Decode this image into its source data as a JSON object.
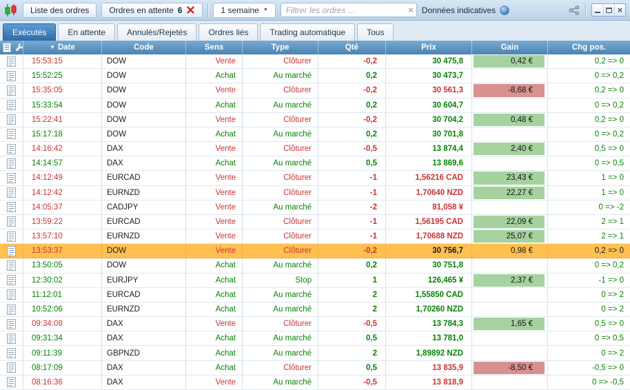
{
  "toolbar": {
    "list_button": "Liste des ordres",
    "pending_button": {
      "label": "Ordres en attente",
      "count": "6"
    },
    "period": "1 semaine",
    "filter_placeholder": "Filtrer les ordres ...",
    "filter_value": "",
    "indicative_label": "Données indicatives"
  },
  "icons": {
    "sort_desc": "▼",
    "dropdown_arrow": "▼",
    "close_glyph": "×",
    "filter_clear": "×"
  },
  "tabs": [
    {
      "id": "executes",
      "label": "Exécutés",
      "active": true
    },
    {
      "id": "en-attente",
      "label": "En attente",
      "active": false
    },
    {
      "id": "annules-rejetes",
      "label": "Annulés/Rejetés",
      "active": false
    },
    {
      "id": "ordres-lies",
      "label": "Ordres liés",
      "active": false
    },
    {
      "id": "trading-automatique",
      "label": "Trading automatique",
      "active": false
    },
    {
      "id": "tous",
      "label": "Tous",
      "active": false
    }
  ],
  "table": {
    "columns": [
      {
        "key": "date",
        "label": "Date",
        "sorted": true
      },
      {
        "key": "code",
        "label": "Code"
      },
      {
        "key": "sens",
        "label": "Sens"
      },
      {
        "key": "type",
        "label": "Type"
      },
      {
        "key": "qty",
        "label": "Qté"
      },
      {
        "key": "price",
        "label": "Prix"
      },
      {
        "key": "gain",
        "label": "Gain"
      },
      {
        "key": "chg",
        "label": "Chg pos."
      }
    ],
    "rows": [
      {
        "time": "15:53:15",
        "code": "DOW",
        "sens": "Vente",
        "type": "Clôturer",
        "qty": "-0,2",
        "price": "30 475,8",
        "price_color": "green",
        "gain": "0,42 €",
        "gain_sign": "pos",
        "chg": "0,2 => 0",
        "highlight": false
      },
      {
        "time": "15:52:25",
        "code": "DOW",
        "sens": "Achat",
        "type": "Au marché",
        "qty": "0,2",
        "price": "30 473,7",
        "price_color": "green",
        "gain": "",
        "gain_sign": "",
        "chg": "0 => 0,2",
        "highlight": false
      },
      {
        "time": "15:35:05",
        "code": "DOW",
        "sens": "Vente",
        "type": "Clôturer",
        "qty": "-0,2",
        "price": "30 561,3",
        "price_color": "red",
        "gain": "-8,68 €",
        "gain_sign": "neg",
        "chg": "0,2 => 0",
        "highlight": false
      },
      {
        "time": "15:33:54",
        "code": "DOW",
        "sens": "Achat",
        "type": "Au marché",
        "qty": "0,2",
        "price": "30 604,7",
        "price_color": "green",
        "gain": "",
        "gain_sign": "",
        "chg": "0 => 0,2",
        "highlight": false
      },
      {
        "time": "15:22:41",
        "code": "DOW",
        "sens": "Vente",
        "type": "Clôturer",
        "qty": "-0,2",
        "price": "30 704,2",
        "price_color": "green",
        "gain": "0,48 €",
        "gain_sign": "pos",
        "chg": "0,2 => 0",
        "highlight": false
      },
      {
        "time": "15:17:18",
        "code": "DOW",
        "sens": "Achat",
        "type": "Au marché",
        "qty": "0,2",
        "price": "30 701,8",
        "price_color": "green",
        "gain": "",
        "gain_sign": "",
        "chg": "0 => 0,2",
        "highlight": false
      },
      {
        "time": "14:16:42",
        "code": "DAX",
        "sens": "Vente",
        "type": "Clôturer",
        "qty": "-0,5",
        "price": "13 874,4",
        "price_color": "green",
        "gain": "2,40 €",
        "gain_sign": "pos",
        "chg": "0,5 => 0",
        "highlight": false
      },
      {
        "time": "14:14:57",
        "code": "DAX",
        "sens": "Achat",
        "type": "Au marché",
        "qty": "0,5",
        "price": "13 869,6",
        "price_color": "green",
        "gain": "",
        "gain_sign": "",
        "chg": "0 => 0,5",
        "highlight": false
      },
      {
        "time": "14:12:49",
        "code": "EURCAD",
        "sens": "Vente",
        "type": "Clôturer",
        "qty": "-1",
        "price": "1,56216 CAD",
        "price_color": "red",
        "gain": "23,43 €",
        "gain_sign": "pos",
        "chg": "1 => 0",
        "highlight": false
      },
      {
        "time": "14:12:42",
        "code": "EURNZD",
        "sens": "Vente",
        "type": "Clôturer",
        "qty": "-1",
        "price": "1,70640 NZD",
        "price_color": "red",
        "gain": "22,27 €",
        "gain_sign": "pos",
        "chg": "1 => 0",
        "highlight": false
      },
      {
        "time": "14:05:37",
        "code": "CADJPY",
        "sens": "Vente",
        "type": "Au marché",
        "qty": "-2",
        "price": "81,058 ¥",
        "price_color": "red",
        "gain": "",
        "gain_sign": "",
        "chg": "0 => -2",
        "highlight": false
      },
      {
        "time": "13:59:22",
        "code": "EURCAD",
        "sens": "Vente",
        "type": "Clôturer",
        "qty": "-1",
        "price": "1,56195 CAD",
        "price_color": "red",
        "gain": "22,09 €",
        "gain_sign": "pos",
        "chg": "2 => 1",
        "highlight": false
      },
      {
        "time": "13:57:10",
        "code": "EURNZD",
        "sens": "Vente",
        "type": "Clôturer",
        "qty": "-1",
        "price": "1,70688 NZD",
        "price_color": "red",
        "gain": "25,07 €",
        "gain_sign": "pos",
        "chg": "2 => 1",
        "highlight": false
      },
      {
        "time": "13:53:37",
        "code": "DOW",
        "sens": "Vente",
        "type": "Clôturer",
        "qty": "-0,2",
        "price": "30 756,7",
        "price_color": "dark",
        "gain": "0,98 €",
        "gain_sign": "",
        "chg": "0,2 => 0",
        "highlight": true
      },
      {
        "time": "13:50:05",
        "code": "DOW",
        "sens": "Achat",
        "type": "Au marché",
        "qty": "0,2",
        "price": "30 751,8",
        "price_color": "green",
        "gain": "",
        "gain_sign": "",
        "chg": "0 => 0,2",
        "highlight": false
      },
      {
        "time": "12:30:02",
        "code": "EURJPY",
        "sens": "Achat",
        "type": "Stop",
        "qty": "1",
        "price": "126,465 ¥",
        "price_color": "green",
        "gain": "2,37 €",
        "gain_sign": "pos",
        "chg": "-1 => 0",
        "highlight": false
      },
      {
        "time": "11:12:01",
        "code": "EURCAD",
        "sens": "Achat",
        "type": "Au marché",
        "qty": "2",
        "price": "1,55850 CAD",
        "price_color": "green",
        "gain": "",
        "gain_sign": "",
        "chg": "0 => 2",
        "highlight": false
      },
      {
        "time": "10:52:06",
        "code": "EURNZD",
        "sens": "Achat",
        "type": "Au marché",
        "qty": "2",
        "price": "1,70260 NZD",
        "price_color": "green",
        "gain": "",
        "gain_sign": "",
        "chg": "0 => 2",
        "highlight": false
      },
      {
        "time": "09:34:08",
        "code": "DAX",
        "sens": "Vente",
        "type": "Clôturer",
        "qty": "-0,5",
        "price": "13 784,3",
        "price_color": "green",
        "gain": "1,65 €",
        "gain_sign": "pos",
        "chg": "0,5 => 0",
        "highlight": false
      },
      {
        "time": "09:31:34",
        "code": "DAX",
        "sens": "Achat",
        "type": "Au marché",
        "qty": "0,5",
        "price": "13 781,0",
        "price_color": "green",
        "gain": "",
        "gain_sign": "",
        "chg": "0 => 0,5",
        "highlight": false
      },
      {
        "time": "09:11:39",
        "code": "GBPNZD",
        "sens": "Achat",
        "type": "Au marché",
        "qty": "2",
        "price": "1,89892 NZD",
        "price_color": "green",
        "gain": "",
        "gain_sign": "",
        "chg": "0 => 2",
        "highlight": false
      },
      {
        "time": "08:17:09",
        "code": "DAX",
        "sens": "Achat",
        "type": "Clôturer",
        "qty": "0,5",
        "price": "13 835,9",
        "price_color": "red",
        "gain": "-8,50 €",
        "gain_sign": "neg",
        "chg": "-0,5 => 0",
        "highlight": false
      },
      {
        "time": "08:16:36",
        "code": "DAX",
        "sens": "Vente",
        "type": "Au marché",
        "qty": "-0,5",
        "price": "13 818,9",
        "price_color": "red",
        "gain": "",
        "gain_sign": "",
        "chg": "0 => -0,5",
        "highlight": false
      }
    ]
  },
  "colors": {
    "sell_red": "#c93434",
    "buy_green": "#068206",
    "gain_pos_bg": "#a5d29e",
    "gain_neg_bg": "#d89090",
    "highlight_row": "#ffc050",
    "header_blue": "#4a83b3"
  }
}
